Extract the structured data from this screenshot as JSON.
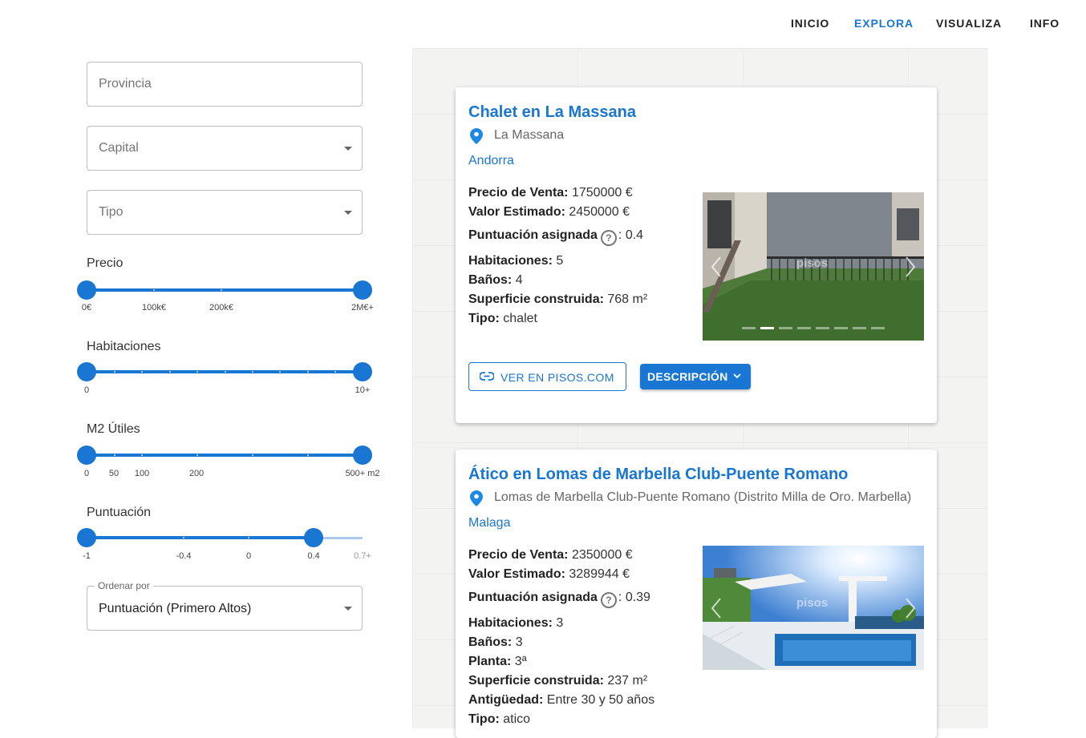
{
  "nav": {
    "items": [
      "INICIO",
      "EXPLORA",
      "VISUALIZA",
      "INFO"
    ],
    "active": "EXPLORA"
  },
  "filters": {
    "provincia_placeholder": "Provincia",
    "capital_placeholder": "Capital",
    "tipo_placeholder": "Tipo",
    "sort_legend": "Ordenar por",
    "sort_value": "Puntuación (Primero Altos)"
  },
  "sliders": {
    "precio": {
      "label": "Precio",
      "ticks": [
        "0€",
        "100k€",
        "200k€",
        "2M€+"
      ],
      "range": [
        "0€",
        "2M€+"
      ]
    },
    "habitaciones": {
      "label": "Habitaciones",
      "ticks": [
        "0",
        "10+"
      ],
      "range": [
        0,
        10
      ]
    },
    "m2": {
      "label": "M2 Útiles",
      "ticks": [
        "0",
        "50",
        "100",
        "200",
        "500+ m2"
      ],
      "range": [
        0,
        500
      ]
    },
    "puntuacion": {
      "label": "Puntuación",
      "ticks": [
        "-1",
        "-0.4",
        "0",
        "0.4",
        "0.7+"
      ],
      "range": [
        -1,
        0.4
      ]
    }
  },
  "listings": [
    {
      "title": "Chalet en La Massana",
      "location": "La Massana",
      "province": "Andorra",
      "precio_label": "Precio de Venta:",
      "precio": "1750000 €",
      "valor_label": "Valor Estimado:",
      "valor": "2450000 €",
      "puntuacion_label": "Puntuación asignada",
      "puntuacion": ": 0.4",
      "hab_label": "Habitaciones:",
      "hab": "5",
      "banos_label": "Baños:",
      "banos": "4",
      "sup_label": "Superficie construida:",
      "sup": "768 m²",
      "tipo_label": "Tipo:",
      "tipo": "chalet",
      "watermark": "pisos",
      "link_button": "VER EN PISOS.COM",
      "desc_button": "DESCRIPCIÓN"
    },
    {
      "title": "Ático en Lomas de Marbella Club-Puente Romano",
      "location": "Lomas de Marbella Club-Puente Romano (Distrito Milla de Oro. Marbella)",
      "province": "Malaga",
      "precio_label": "Precio de Venta:",
      "precio": "2350000 €",
      "valor_label": "Valor Estimado:",
      "valor": "3289944 €",
      "puntuacion_label": "Puntuación asignada",
      "puntuacion": ": 0.39",
      "hab_label": "Habitaciones:",
      "hab": "3",
      "banos_label": "Baños:",
      "banos": "3",
      "planta_label": "Planta:",
      "planta": "3ª",
      "sup_label": "Superficie construida:",
      "sup": "237 m²",
      "antig_label": "Antigüedad:",
      "antig": "Entre 30 y 50 años",
      "tipo_label": "Tipo:",
      "tipo": "atico",
      "watermark": "pisos"
    }
  ],
  "help_glyph": "?",
  "colors": {
    "accent": "#1976d2",
    "track_light": "#a9c9ee"
  }
}
